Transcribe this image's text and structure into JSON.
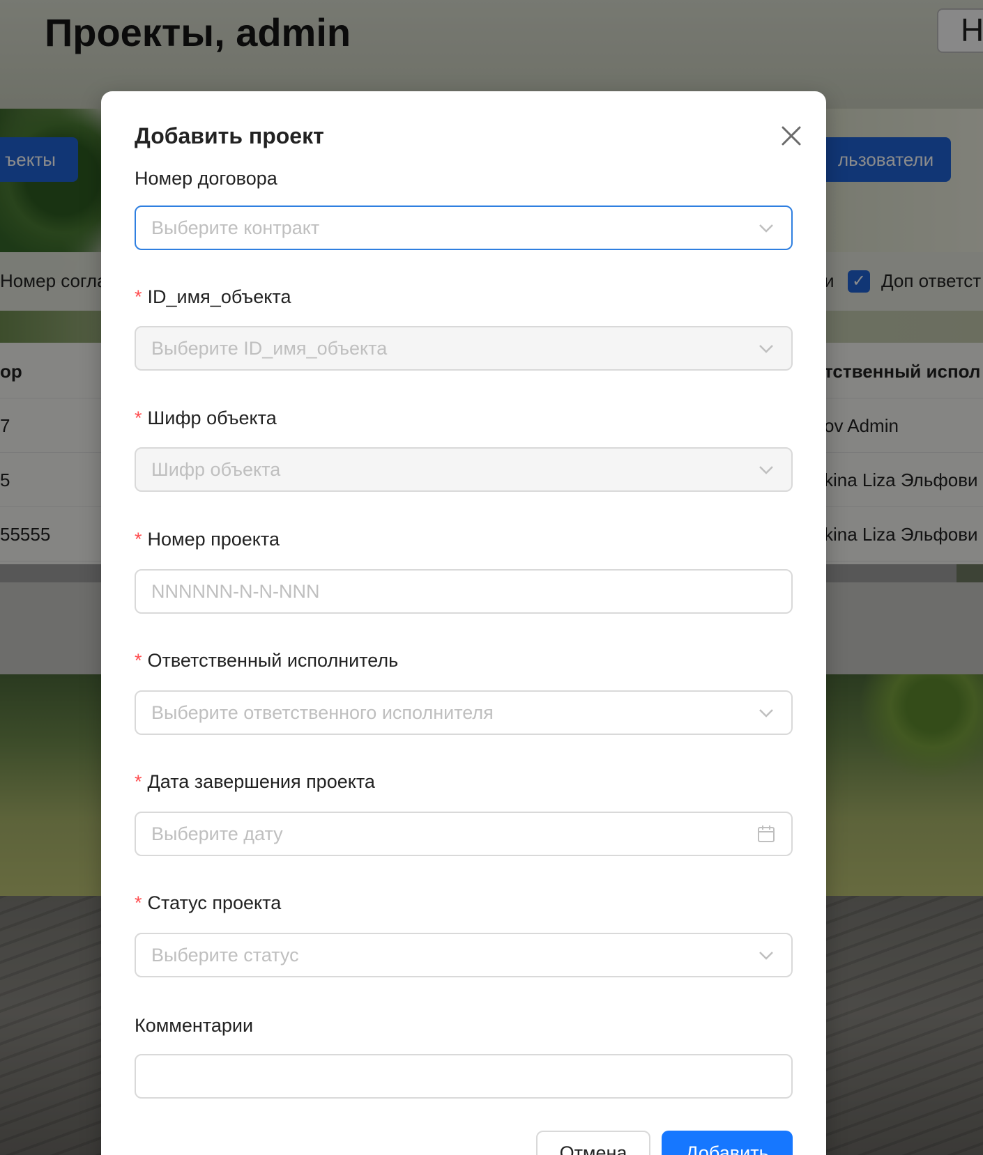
{
  "page": {
    "title": "Проекты, admin",
    "top_button_label": "Н",
    "buttons": {
      "left": "ъекты",
      "right": "льзователи"
    },
    "filters": {
      "left_text": "Номер согла",
      "right_text_1": "и",
      "right_text_2": "Доп ответст"
    },
    "table": {
      "headers": {
        "left": "ор",
        "right": "тственный испол"
      },
      "rows": [
        {
          "left": "7",
          "right": "ov Admin"
        },
        {
          "left": "5",
          "right": "kina Liza Эльфови"
        },
        {
          "left": "55555",
          "right": "kina Liza Эльфови"
        }
      ]
    }
  },
  "modal": {
    "title": "Добавить проект",
    "fields": {
      "contract": {
        "label": "Номер договора",
        "placeholder": "Выберите контракт"
      },
      "object_id": {
        "label": "ID_имя_объекта",
        "placeholder": "Выберите ID_имя_объекта"
      },
      "object_code": {
        "label": "Шифр объекта",
        "placeholder": "Шифр объекта"
      },
      "project_number": {
        "label": "Номер проекта",
        "placeholder": "NNNNNN-N-N-NNN"
      },
      "executor": {
        "label": "Ответственный исполнитель",
        "placeholder": "Выберите ответственного исполнителя"
      },
      "end_date": {
        "label": "Дата завершения проекта",
        "placeholder": "Выберите дату"
      },
      "status": {
        "label": "Статус проекта",
        "placeholder": "Выберите статус"
      },
      "comments": {
        "label": "Комментарии",
        "value": ""
      }
    },
    "required_mark": "*",
    "cancel_label": "Отмена",
    "submit_label": "Добавить"
  },
  "colors": {
    "primary": "#1677ff",
    "required": "#ff4d4f",
    "focus_border": "#2f7fe0",
    "placeholder": "#bfbfbf"
  },
  "icons": {
    "close": "close-icon",
    "select_arrow": "chevron-down-icon",
    "date": "calendar-icon",
    "checkbox": "check-icon"
  }
}
